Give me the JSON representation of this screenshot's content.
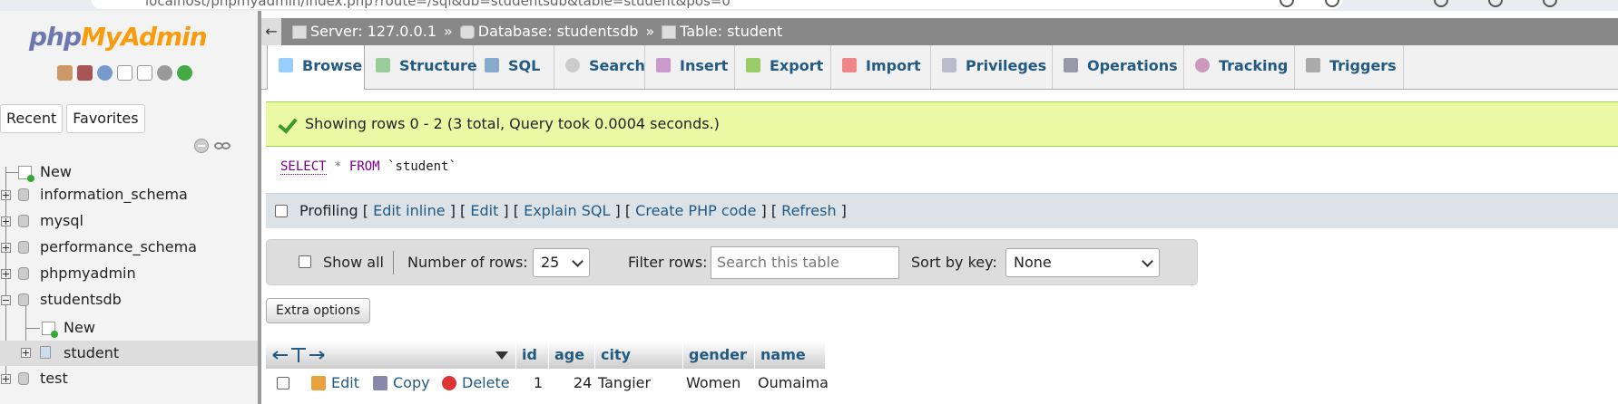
{
  "browser": {
    "url": "localhost/phpmyadmin/index.php?route=/sql&db=studentsdb&table=student&pos=0"
  },
  "logo": {
    "part1": "php",
    "part2": "MyAdmin"
  },
  "nav": {
    "tabs": [
      "Recent",
      "Favorites"
    ],
    "tree": {
      "new": "New",
      "databases": [
        "information_schema",
        "mysql",
        "performance_schema",
        "phpmyadmin",
        "studentsdb",
        "test"
      ],
      "studentsdb_children": {
        "new": "New",
        "table": "student"
      }
    }
  },
  "breadcrumb": {
    "back": "←",
    "server": "Server: 127.0.0.1",
    "sep1": "»",
    "database": "Database: studentsdb",
    "sep2": "»",
    "table": "Table: student"
  },
  "tabs": [
    "Browse",
    "Structure",
    "SQL",
    "Search",
    "Insert",
    "Export",
    "Import",
    "Privileges",
    "Operations",
    "Tracking",
    "Triggers"
  ],
  "message": "Showing rows 0 - 2 (3 total, Query took 0.0004 seconds.)",
  "sql": {
    "select": "SELECT",
    "star": "*",
    "from": "FROM",
    "table": "`student`"
  },
  "profiling": {
    "label": "Profiling",
    "links": [
      "Edit inline",
      "Edit",
      "Explain SQL",
      "Create PHP code",
      "Refresh"
    ]
  },
  "navbar": {
    "show_all": "Show all",
    "rows_label": "Number of rows:",
    "rows_value": "25",
    "filter_label": "Filter rows:",
    "filter_placeholder": "Search this table",
    "sort_label": "Sort by key:",
    "sort_value": "None"
  },
  "extra_options": "Extra options",
  "table": {
    "columns": [
      "id",
      "age",
      "city",
      "gender",
      "name"
    ],
    "row_actions": {
      "edit": "Edit",
      "copy": "Copy",
      "delete": "Delete"
    },
    "rows": [
      {
        "id": "1",
        "age": "24",
        "city": "Tangier",
        "gender": "Women",
        "name": "Oumaima"
      }
    ]
  },
  "colors": {
    "accent": "#235a81",
    "success_bg": "#ebf8a4",
    "logo_php": "#6c78af",
    "logo_myadmin": "#f89c0e"
  }
}
